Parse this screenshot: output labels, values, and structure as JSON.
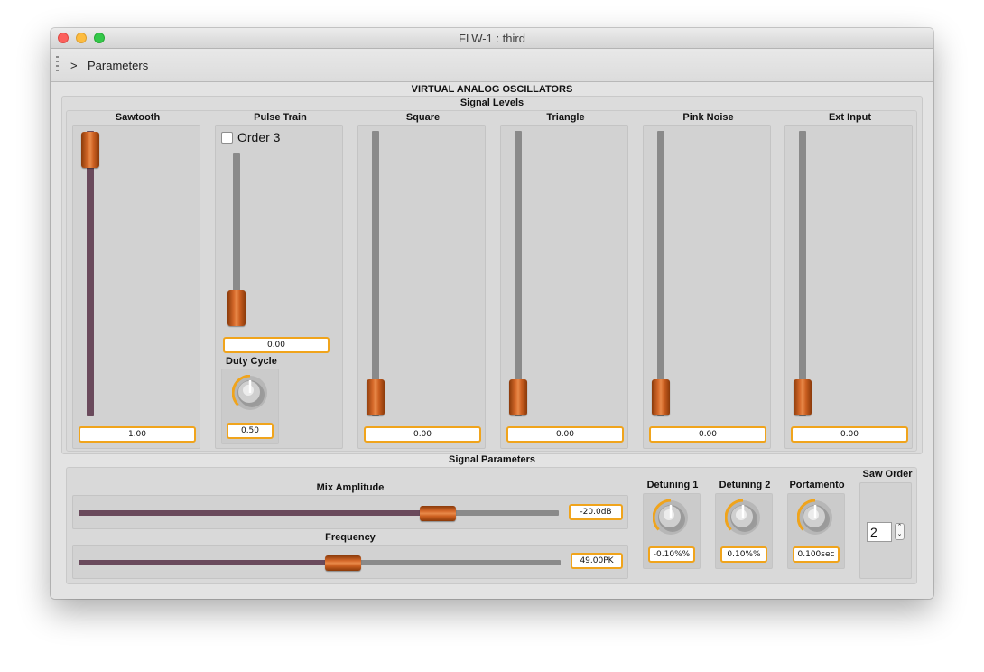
{
  "window": {
    "title": "FLW-1 : third"
  },
  "toolbar": {
    "arrow": ">",
    "label": "Parameters"
  },
  "main": {
    "title": "VIRTUAL ANALOG OSCILLATORS"
  },
  "signal_levels": {
    "title": "Signal Levels",
    "sawtooth": {
      "label": "Sawtooth",
      "value_text": "1.00",
      "level": 1.0
    },
    "pulse_train": {
      "label": "Pulse Train",
      "checkbox_label": "Order 3",
      "checked": false,
      "value_text": "0.00",
      "level": 0.0,
      "duty_cycle": {
        "label": "Duty Cycle",
        "value_text": "0.50",
        "knob": 0.5
      }
    },
    "square": {
      "label": "Square",
      "value_text": "0.00",
      "level": 0.0
    },
    "triangle": {
      "label": "Triangle",
      "value_text": "0.00",
      "level": 0.0
    },
    "pink_noise": {
      "label": "Pink Noise",
      "value_text": "0.00",
      "level": 0.0
    },
    "ext_input": {
      "label": "Ext Input",
      "value_text": "0.00",
      "level": 0.0
    }
  },
  "signal_parameters": {
    "title": "Signal Parameters",
    "mix_amplitude": {
      "label": "Mix Amplitude",
      "value_text": "-20.0dB",
      "level": 0.8
    },
    "frequency": {
      "label": "Frequency",
      "value_text": "49.00PK",
      "level": 0.53
    },
    "detuning1": {
      "label": "Detuning 1",
      "value_text": "-0.10%%",
      "knob": 0.5
    },
    "detuning2": {
      "label": "Detuning 2",
      "value_text": "0.10%%",
      "knob": 0.5
    },
    "portamento": {
      "label": "Portamento",
      "value_text": "0.100sec",
      "knob": 0.5
    },
    "saw_order": {
      "label": "Saw Order",
      "value": "2",
      "up": "⌃",
      "down": "⌄"
    }
  },
  "colors": {
    "accent": "#f0a41c",
    "handle": "#d6692a",
    "fill": "#6a4a5c",
    "track": "#8a8a8a"
  }
}
